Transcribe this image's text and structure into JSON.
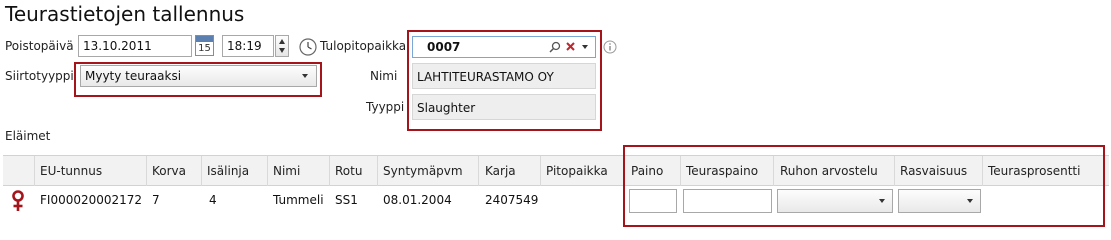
{
  "page": {
    "title": "Teurastietojen tallennus"
  },
  "form": {
    "poistopaiva_label": "Poistopäivä",
    "poistopaiva_value": "13.10.2011",
    "calendar_day": "15",
    "time_value": "18:19",
    "tulopitopaikka_label": "Tulopitopaikka",
    "tulopitopaikka_value": "0007",
    "siirtotyyppi_label": "Siirtotyyppi",
    "siirtotyyppi_value": "Myyty teuraaksi",
    "nimi_label": "Nimi",
    "nimi_value": "LAHTITEURASTAMO OY",
    "tyyppi_label": "Tyyppi",
    "tyyppi_value": "Slaughter"
  },
  "grid": {
    "section_label": "Eläimet",
    "columns": [
      "EU-tunnus",
      "Korva",
      "Isälinja",
      "Nimi",
      "Rotu",
      "Syntymäpvm",
      "Karja",
      "Pitopaikka",
      "Paino",
      "Teuraspaino",
      "Ruhon arvostelu",
      "Rasvaisuus",
      "Teurasprosentti"
    ],
    "rows": [
      {
        "sex_icon": "female-icon",
        "eu_tunnus": "FI000020002172",
        "korva": "7",
        "isalinja": "4",
        "nimi": "Tummeli",
        "rotu": "SS1",
        "syntymapvm": "08.01.2004",
        "karja": "2407549",
        "pitopaikka": "",
        "paino": "",
        "teuraspaino": "",
        "ruhon_arvostelu": "",
        "rasvaisuus": ""
      }
    ]
  },
  "colors": {
    "highlight_border": "#a5141b",
    "female_symbol": "#a5141b",
    "header_bg": "#f2f2f2"
  }
}
